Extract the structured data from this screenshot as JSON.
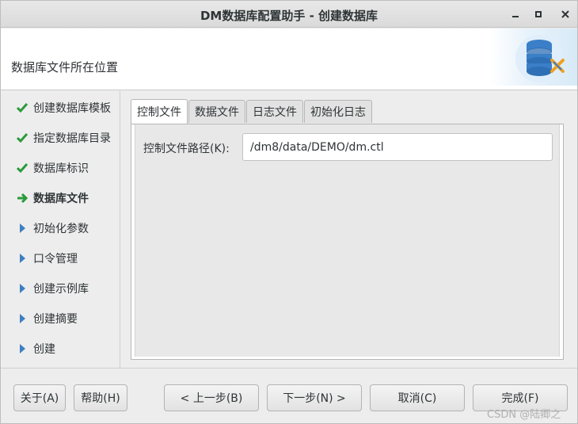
{
  "window": {
    "title": "DM数据库配置助手 - 创建数据库"
  },
  "header": {
    "heading": "数据库文件所在位置",
    "logo_icon": "database-settings-icon"
  },
  "steps": [
    {
      "label": "创建数据库模板",
      "status": "done"
    },
    {
      "label": "指定数据库目录",
      "status": "done"
    },
    {
      "label": "数据库标识",
      "status": "done"
    },
    {
      "label": "数据库文件",
      "status": "current"
    },
    {
      "label": "初始化参数",
      "status": "pending"
    },
    {
      "label": "口令管理",
      "status": "pending"
    },
    {
      "label": "创建示例库",
      "status": "pending"
    },
    {
      "label": "创建摘要",
      "status": "pending"
    },
    {
      "label": "创建",
      "status": "pending"
    }
  ],
  "tabs": [
    {
      "label": "控制文件",
      "active": true
    },
    {
      "label": "数据文件",
      "active": false
    },
    {
      "label": "日志文件",
      "active": false
    },
    {
      "label": "初始化日志",
      "active": false
    }
  ],
  "control_file": {
    "label": "控制文件路径(K):",
    "value": "/dm8/data/DEMO/dm.ctl"
  },
  "buttons": {
    "about": "关于(A)",
    "help": "帮助(H)",
    "prev": "< 上一步(B)",
    "next": "下一步(N) >",
    "cancel": "取消(C)",
    "finish": "完成(F)"
  },
  "watermark": "CSDN @陆卿之",
  "colors": {
    "check_green": "#2a9a3a",
    "arrow_green": "#2a9a3a",
    "pending_blue": "#3d7fc1"
  }
}
